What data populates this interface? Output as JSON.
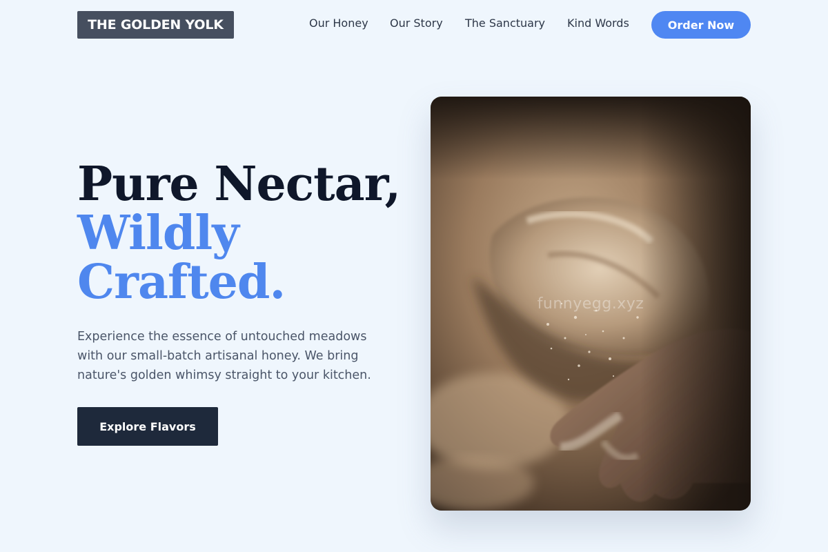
{
  "brand": {
    "name": "THE GOLDEN YOLK"
  },
  "nav": {
    "items": [
      {
        "label": "Our Honey"
      },
      {
        "label": "Our Story"
      },
      {
        "label": "The Sanctuary"
      },
      {
        "label": "Kind Words"
      }
    ],
    "cta_label": "Order Now"
  },
  "hero": {
    "headline_line1": "Pure Nectar,",
    "headline_line2": "Wildly",
    "headline_line3": "Crafted.",
    "description": "Experience the essence of untouched meadows with our small-batch artisanal honey. We bring nature's golden whimsy straight to your kitchen.",
    "cta_label": "Explore Flavors",
    "image": {
      "subject": "floured hands kneading dough",
      "watermark": "funnyegg.xyz"
    }
  },
  "colors": {
    "background": "#eff6fd",
    "accent": "#4f87f2",
    "dark": "#0f172a",
    "button_dark": "#1e293b",
    "logo_bg": "#464f5f"
  }
}
